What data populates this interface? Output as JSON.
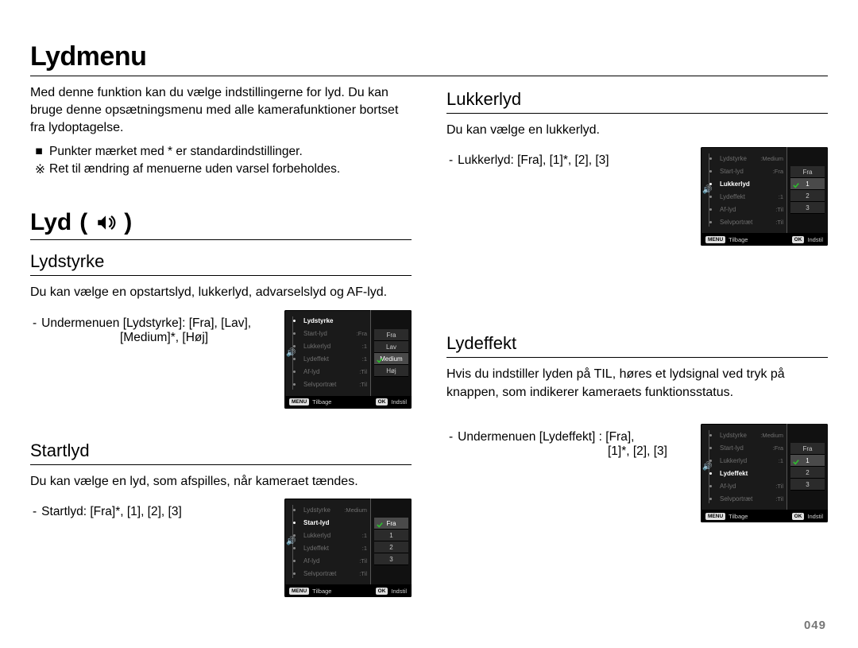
{
  "page_number": "049",
  "title": "Lydmenu",
  "intro": "Med denne funktion kan du vælge indstillingerne for lyd. Du kan bruge denne opsætningsmenu med alle kamerafunktioner bortset fra lydoptagelse.",
  "note_bullets": [
    {
      "marker": "■",
      "text": "Punkter mærket med * er standardindstillinger."
    },
    {
      "marker": "※",
      "text": "Ret til ændring af menuerne uden varsel forbeholdes."
    }
  ],
  "sound_section": {
    "heading": "Lyd",
    "icon_name": "speaker-icon"
  },
  "subsections": {
    "lydstyrke": {
      "heading": "Lydstyrke",
      "body": "Du kan vælge en opstartslyd, lukkerlyd, advarselslyd og AF-lyd.",
      "option_line_1": "Undermenuen [Lydstyrke]: [Fra], [Lav],",
      "option_line_2": "[Medium]*, [Høj]"
    },
    "startlyd": {
      "heading": "Startlyd",
      "body": "Du kan vælge en lyd, som afspilles, når kameraet tændes.",
      "option_line": "Startlyd: [Fra]*, [1], [2], [3]"
    },
    "lukkerlyd": {
      "heading": "Lukkerlyd",
      "body": "Du kan vælge en lukkerlyd.",
      "option_line": "Lukkerlyd: [Fra], [1]*, [2], [3]"
    },
    "lydeffekt": {
      "heading": "Lydeffekt",
      "body": "Hvis du indstiller lyden på TIL, høres et lydsignal ved tryk på knappen, som indikerer kameraets funktionsstatus.",
      "option_line_1": "Undermenuen [Lydeffekt] : [Fra],",
      "option_line_2": "[1]*, [2], [3]"
    }
  },
  "screenshots": {
    "menu_items": [
      {
        "key": "lydstyrke",
        "label": "Lydstyrke",
        "value": "Medium"
      },
      {
        "key": "startlyd",
        "label": "Start-lyd",
        "value": "Fra"
      },
      {
        "key": "lukkerlyd",
        "label": "Lukkerlyd",
        "value": "1"
      },
      {
        "key": "lydeffekt",
        "label": "Lydeffekt",
        "value": "1"
      },
      {
        "key": "aflyd",
        "label": "Af-lyd",
        "value": "Til"
      },
      {
        "key": "selvportraet",
        "label": "Selvportræt",
        "value": "Til"
      }
    ],
    "footer": {
      "back_btn": "MENU",
      "back_label": "Tilbage",
      "set_btn": "OK",
      "set_label": "Indstil"
    },
    "variants": {
      "lydstyrke": {
        "active": "lydstyrke",
        "options": [
          "Fra",
          "Lav",
          "Medium",
          "Høj"
        ],
        "selected": "Medium"
      },
      "startlyd": {
        "active": "startlyd",
        "options": [
          "Fra",
          "1",
          "2",
          "3"
        ],
        "selected": "Fra"
      },
      "lukkerlyd": {
        "active": "lukkerlyd",
        "options": [
          "Fra",
          "1",
          "2",
          "3"
        ],
        "selected": "1"
      },
      "lydeffekt": {
        "active": "lydeffekt",
        "options": [
          "Fra",
          "1",
          "2",
          "3"
        ],
        "selected": "1"
      }
    }
  }
}
